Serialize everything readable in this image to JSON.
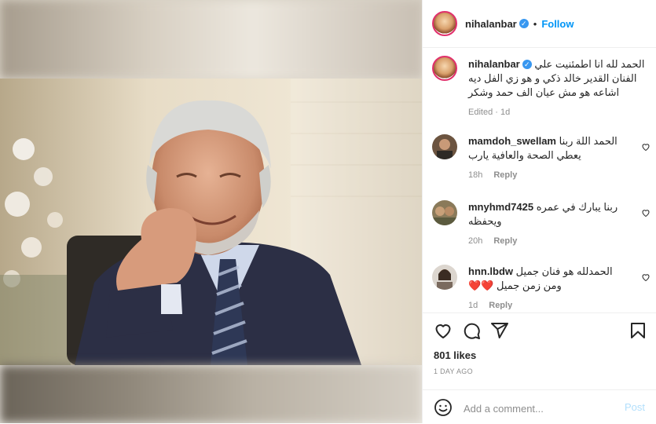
{
  "header": {
    "username": "nihalanbar",
    "separator": "•",
    "follow_label": "Follow"
  },
  "caption": {
    "username": "nihalanbar",
    "text": "الحمد لله انا اطمئنيت علي الفنان القدير خالد ذكي و هو زي الفل ديه اشاعه هو مش عيان الف حمد وشكر",
    "meta": "Edited · 1d"
  },
  "comments": [
    {
      "username": "mamdoh_swellam",
      "text": "الحمد اللة ربنا يعطي الصحة والعافية يارب",
      "time": "18h",
      "reply": "Reply"
    },
    {
      "username": "mnyhmd7425",
      "text": "ربنا يبارك في عمره ويحفظه",
      "time": "20h",
      "reply": "Reply"
    },
    {
      "username": "hnn.lbdw",
      "text": "الحمدلله هو فنان جميل ومن زمن جميل ❤️❤️",
      "time": "1d",
      "reply": "Reply"
    }
  ],
  "likes": "801 likes",
  "time_ago": "1 DAY AGO",
  "add_comment": {
    "placeholder": "Add a comment...",
    "post_label": "Post"
  },
  "icons": {
    "like": "heart-icon",
    "comment": "comment-icon",
    "share": "share-icon",
    "save": "bookmark-icon",
    "emoji": "emoji-icon",
    "verified": "verified-badge-icon"
  },
  "colors": {
    "accent": "#0095f6",
    "verified": "#3897f0",
    "muted": "#8e8e8e",
    "post_disabled": "#b2dffc"
  }
}
